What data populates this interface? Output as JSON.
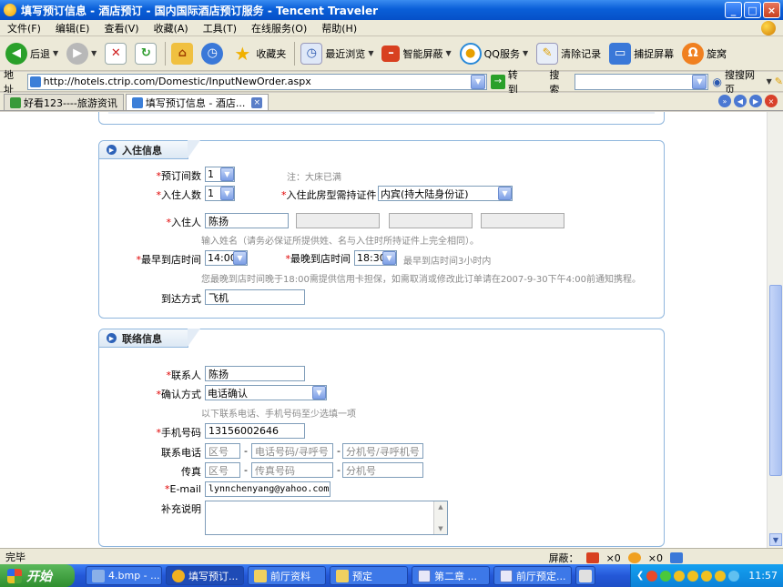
{
  "window": {
    "title": "填写预订信息 - 酒店预订 - 国内国际酒店预订服务 - Tencent Traveler"
  },
  "menu": [
    "文件(F)",
    "编辑(E)",
    "查看(V)",
    "收藏(A)",
    "工具(T)",
    "在线服务(O)",
    "帮助(H)"
  ],
  "toolbar": {
    "back": "后退",
    "favorites": "收藏夹",
    "recent": "最近浏览",
    "smart_screen": "智能屏蔽",
    "qq_service": "QQ服务",
    "clear_history": "清除记录",
    "capture": "捕捉屏幕",
    "xuanwo": "旋窝"
  },
  "address": {
    "label": "地址",
    "url": "http://hotels.ctrip.com/Domestic/InputNewOrder.aspx",
    "go": "转到",
    "search_label": "搜索",
    "sogou": "搜搜网页"
  },
  "tabs": [
    {
      "label": "好看123----旅游资讯"
    },
    {
      "label": "填写预订信息 - 酒店..."
    }
  ],
  "checkin": {
    "header": "入住信息",
    "rooms_label": "预订间数",
    "rooms_value": "1",
    "rooms_note": "注：大床已满",
    "guests_label": "入住人数",
    "guests_value": "1",
    "id_label": "入住此房型需持证件",
    "id_value": "内宾(持大陆身份证)",
    "guest_label": "入住人",
    "guest_value": "陈扬",
    "name_note": "输入姓名（请务必保证所提供姓、名与入住时所持证件上完全相同）。",
    "earliest_label": "最早到店时间",
    "earliest_value": "14:00",
    "latest_label": "最晚到店时间",
    "latest_value": "18:30",
    "latest_note": "最早到店时间3小时内",
    "time_note": "您最晚到店时间晚于18:00需提供信用卡担保，如需取消或修改此订单请在2007-9-30下午4:00前通知携程。",
    "transport_label": "到达方式",
    "transport_value": "飞机"
  },
  "contact": {
    "header": "联络信息",
    "name_label": "联系人",
    "name_value": "陈扬",
    "confirm_label": "确认方式",
    "confirm_value": "电话确认",
    "confirm_note": "以下联系电话、手机号码至少选填一项",
    "mobile_label": "手机号码",
    "mobile_value": "13156002646",
    "phone_label": "联系电话",
    "phone_area": "区号",
    "phone_number": "电话号码/寻呼号",
    "phone_ext": "分机号/寻呼机号",
    "fax_label": "传真",
    "fax_area": "区号",
    "fax_number": "传真号码",
    "fax_ext": "分机号",
    "email_label": "E-mail",
    "email_value": "lynnchenyang@yahoo.com.cn",
    "remarks_label": "补充说明"
  },
  "status": {
    "text": "完毕",
    "shield_label": "屏蔽：",
    "count1": "×0",
    "count2": "×0"
  },
  "taskbar": {
    "start": "开始",
    "tasks": [
      "4.bmp - ...",
      "填写预订...",
      "前厅资料",
      "预定",
      "第二章 ...",
      "前厅预定...",
      "..."
    ],
    "clock": "11:57"
  }
}
